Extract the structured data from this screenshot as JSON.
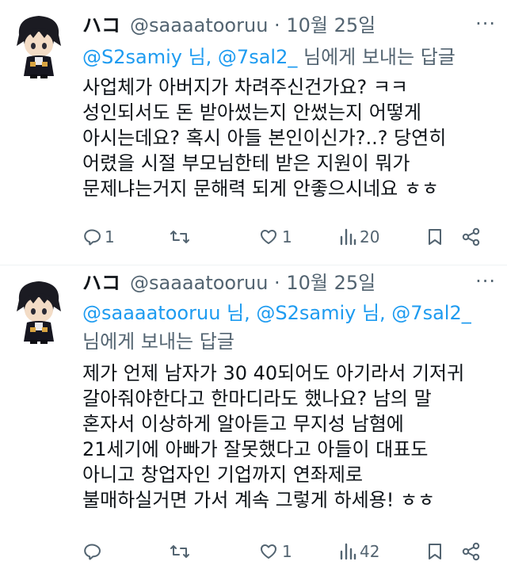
{
  "tweets": [
    {
      "author_name": "ハコ",
      "handle": "@saaaatooruu",
      "dot": "·",
      "date": "10월 25일",
      "more": "···",
      "reply_mentions": "@S2samiy 님, @7sal2_",
      "reply_suffix": " 님에게 보내는 답글",
      "lines": [
        "사업체가 아버지가 차려주신건가요? ㅋㅋ",
        "성인되서도 돈 받아썼는지 안썼는지 어떻게",
        "아시는데요? 혹시 아들 본인이신가?..? 당연히",
        "어렸을 시절 부모님한테 받은 지원이 뭐가",
        "문제냐는거지 문해력 되게 안좋으시네요 ㅎㅎ"
      ],
      "stats": {
        "replies": "1",
        "retweets": "",
        "likes": "1",
        "views": "20"
      }
    },
    {
      "author_name": "ハコ",
      "handle": "@saaaatooruu",
      "dot": "·",
      "date": "10월 25일",
      "more": "···",
      "reply_line1": "@saaaatooruu 님, @S2samiy 님, @7sal2_",
      "reply_line2": "님에게 보내는 답글",
      "lines": [
        "제가 언제 남자가 30 40되어도 아기라서 기저귀",
        "갈아줘야한다고 한마디라도 했나요? 남의 말",
        "혼자서 이상하게 알아듣고 무지성 남혐에",
        "21세기에 아빠가 잘못했다고 아들이 대표도",
        "아니고 창업자인 기업까지 연좌제로",
        "불매하실거면 가서 계속 그렇게 하세용! ㅎㅎ"
      ],
      "stats": {
        "replies": "",
        "retweets": "",
        "likes": "1",
        "views": "42"
      }
    }
  ],
  "colors": {
    "text": "#0f1419",
    "secondary": "#536471",
    "link": "#1d9bf0",
    "divider": "#eff3f4"
  },
  "icons": [
    "avatar-anime-figure",
    "reply-icon",
    "retweet-icon",
    "like-icon",
    "views-icon",
    "bookmark-icon",
    "share-icon",
    "more-icon"
  ]
}
